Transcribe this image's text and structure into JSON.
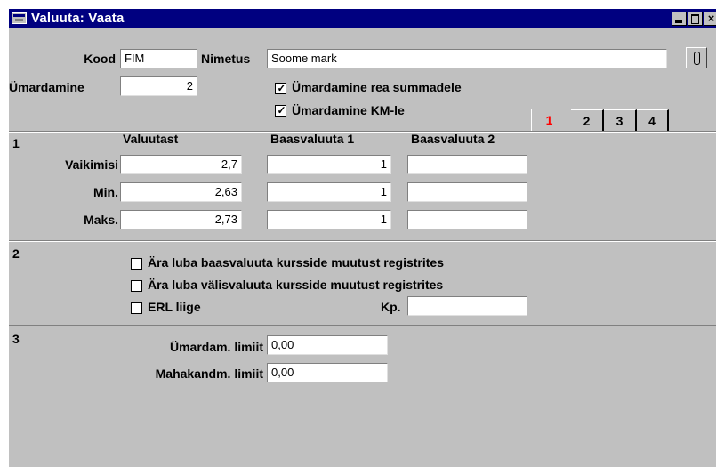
{
  "window": {
    "title": "Valuuta: Vaata",
    "buttons": {
      "minimize": "minimize-button",
      "maximize": "maximize-button",
      "close": "×"
    }
  },
  "header": {
    "kood_label": "Kood",
    "kood_value": "FIM",
    "nimetus_label": "Nimetus",
    "nimetus_value": "Soome mark",
    "umardamine_label": "Ümardamine",
    "umardamine_value": "2",
    "checkboxes": [
      {
        "label": "Ümardamine rea summadele",
        "checked": true
      },
      {
        "label": "Ümardamine KM-le",
        "checked": true
      }
    ],
    "attachment_icon": "paperclip-icon"
  },
  "tabs": [
    {
      "label": "1",
      "active": true
    },
    {
      "label": "2",
      "active": false
    },
    {
      "label": "3",
      "active": false
    },
    {
      "label": "4",
      "active": false
    }
  ],
  "section1": {
    "number": "1",
    "columns": [
      "Valuutast",
      "Baasvaluuta 1",
      "Baasvaluuta 2"
    ],
    "rows": [
      {
        "label": "Vaikimisi",
        "valuutast": "2,7",
        "baas1": "1",
        "baas2": ""
      },
      {
        "label": "Min.",
        "valuutast": "2,63",
        "baas1": "1",
        "baas2": ""
      },
      {
        "label": "Maks.",
        "valuutast": "2,73",
        "baas1": "1",
        "baas2": ""
      }
    ]
  },
  "section2": {
    "number": "2",
    "checkboxes": [
      {
        "label": "Ära luba baasvaluuta kursside muutust registrites",
        "checked": false
      },
      {
        "label": "Ära luba välisvaluuta kursside muutust registrites",
        "checked": false
      },
      {
        "label": "ERL liige",
        "checked": false
      }
    ],
    "kp_label": "Kp.",
    "kp_value": ""
  },
  "section3": {
    "number": "3",
    "umardam_label": "Ümardam. limiit",
    "umardam_value": "0,00",
    "mahakandm_label": "Mahakandm. limiit",
    "mahakandm_value": "0,00"
  },
  "colors": {
    "titlebar": "#000080",
    "face": "#c0c0c0",
    "active_tab": "#ff0000"
  }
}
